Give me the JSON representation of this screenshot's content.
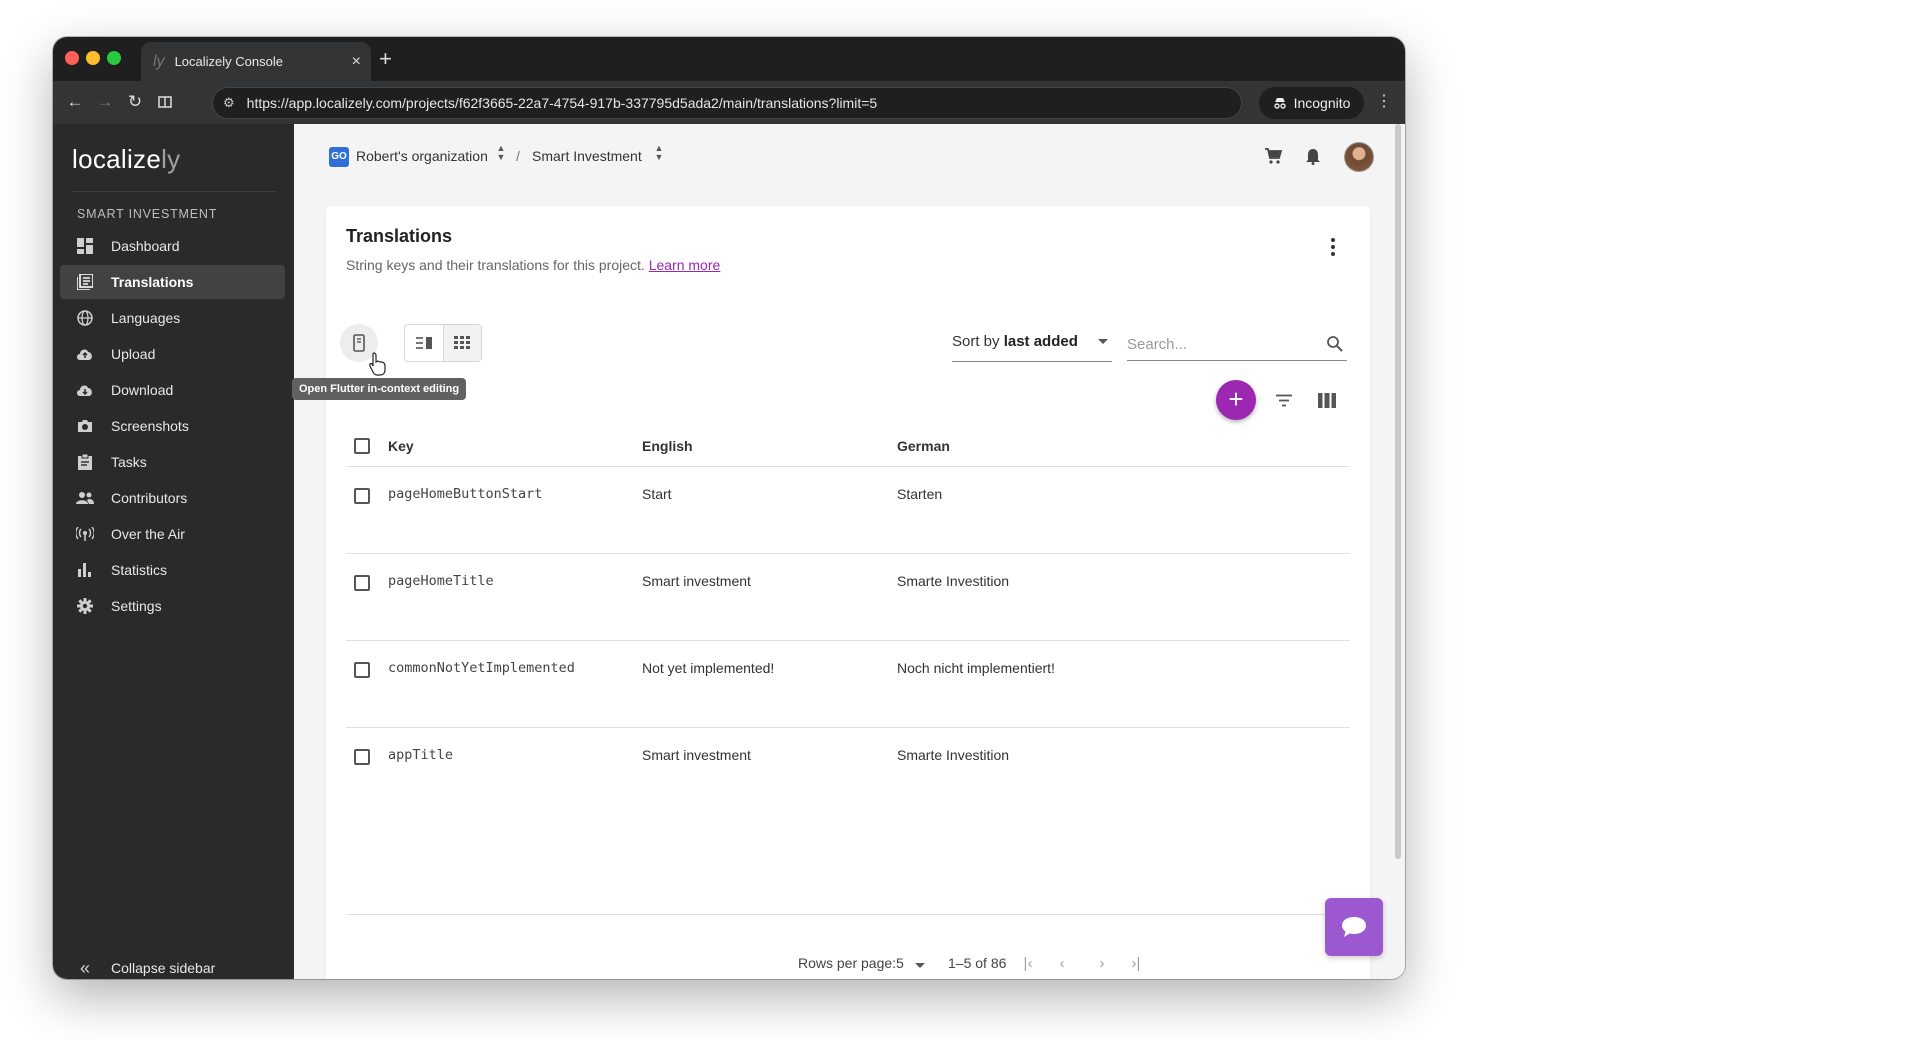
{
  "browser": {
    "tab_title": "Localizely Console",
    "tab_favicon": "ly",
    "tab_close": "×",
    "new_tab": "+",
    "url": "https://app.localizely.com/projects/f62f3665-22a7-4754-917b-337795d5ada2/main/translations?limit=5",
    "incognito_label": "Incognito"
  },
  "sidebar": {
    "logo_main": "localize",
    "logo_suffix": "ly",
    "section_title": "SMART INVESTMENT",
    "items": [
      {
        "label": "Dashboard",
        "icon": "dashboard-icon"
      },
      {
        "label": "Translations",
        "icon": "translations-icon",
        "active": true
      },
      {
        "label": "Languages",
        "icon": "globe-icon"
      },
      {
        "label": "Upload",
        "icon": "cloud-upload-icon"
      },
      {
        "label": "Download",
        "icon": "cloud-download-icon"
      },
      {
        "label": "Screenshots",
        "icon": "camera-icon"
      },
      {
        "label": "Tasks",
        "icon": "clipboard-icon"
      },
      {
        "label": "Contributors",
        "icon": "people-icon"
      },
      {
        "label": "Over the Air",
        "icon": "antenna-icon"
      },
      {
        "label": "Statistics",
        "icon": "bar-chart-icon"
      },
      {
        "label": "Settings",
        "icon": "gear-icon"
      }
    ],
    "collapse_label": "Collapse sidebar"
  },
  "header": {
    "org_badge": "GO",
    "org_name": "Robert's organization",
    "separator": "/",
    "project_name": "Smart Investment"
  },
  "page": {
    "title": "Translations",
    "subtitle": "String keys and their translations for this project.",
    "learn_more": "Learn more",
    "tooltip": "Open Flutter in-context editing",
    "sort_prefix": "Sort by",
    "sort_value": "last added",
    "search_placeholder": "Search...",
    "fab_label": "+"
  },
  "table": {
    "columns": {
      "key": "Key",
      "english": "English",
      "german": "German"
    },
    "rows": [
      {
        "key": "pageHomeButtonStart",
        "english": "Start",
        "german": "Starten"
      },
      {
        "key": "pageHomeTitle",
        "english": "Smart investment",
        "german": "Smarte Investition"
      },
      {
        "key": "commonNotYetImplemented",
        "english": "Not yet implemented!",
        "german": "Noch nicht implementiert!"
      },
      {
        "key": "appTitle",
        "english": "Smart investment",
        "german": "Smarte Investition"
      }
    ]
  },
  "pagination": {
    "rows_per_page_label": "Rows per page:",
    "rows_per_page": "5",
    "range": "1–5 of 86"
  },
  "colors": {
    "accent": "#9c27b0",
    "sidebar_bg": "#2a2a2a",
    "chat_button": "#9c59cf"
  }
}
